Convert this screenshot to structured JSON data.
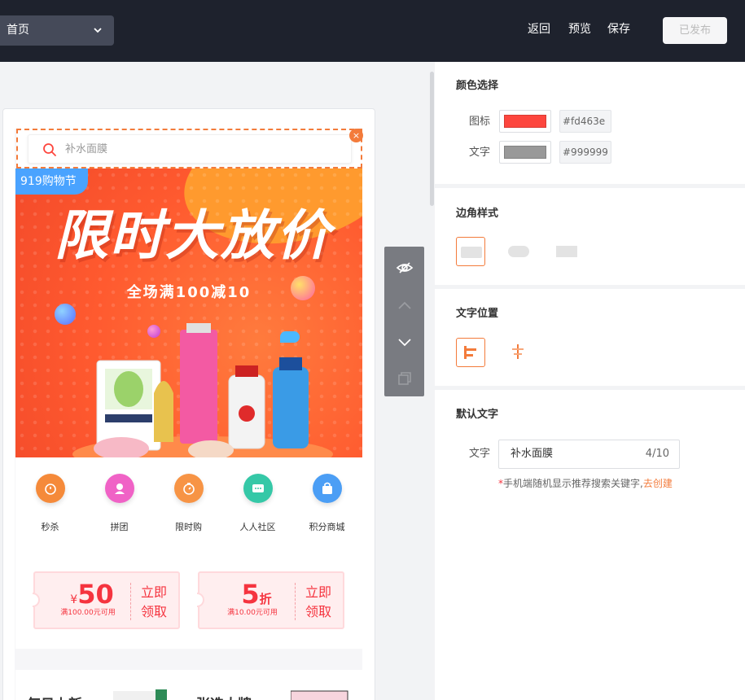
{
  "topbar": {
    "page_select": "首页",
    "back_label": "返回",
    "preview_label": "预览",
    "save_label": "保存",
    "publish_label": "已发布"
  },
  "preview": {
    "search_placeholder": "补水面膜",
    "close_symbol": "×",
    "banner": {
      "tag": "919购物节",
      "title": "限时大放价",
      "subtitle": "全场满100减10",
      "bg_color": "#ff5a2f"
    },
    "nav_items": [
      {
        "label": "秒杀",
        "color": "#f58a3a",
        "icon": "stopwatch-icon"
      },
      {
        "label": "拼团",
        "color": "#f062c6",
        "icon": "group-icon"
      },
      {
        "label": "限时购",
        "color": "#f79445",
        "icon": "timer-icon"
      },
      {
        "label": "人人社区",
        "color": "#35c8a7",
        "icon": "chat-icon"
      },
      {
        "label": "积分商城",
        "color": "#4b9ef5",
        "icon": "bag-icon"
      }
    ],
    "coupons": [
      {
        "currency": "¥",
        "amount": "50",
        "unit": "",
        "condition": "满100.00元可用",
        "cta_line1": "立即",
        "cta_line2": "领取"
      },
      {
        "currency": "",
        "amount": "5",
        "unit": "折",
        "condition": "满10.00元可用",
        "cta_line1": "立即",
        "cta_line2": "领取"
      }
    ],
    "section_titles": [
      "每日上新",
      "张选大牌"
    ]
  },
  "panel": {
    "color_section": {
      "title": "颜色选择",
      "rows": [
        {
          "label": "图标",
          "color": "#fd463e",
          "hex": "#fd463e"
        },
        {
          "label": "文字",
          "color": "#999999",
          "hex": "#999999"
        }
      ]
    },
    "corner_section": {
      "title": "边角样式"
    },
    "text_pos_section": {
      "title": "文字位置"
    },
    "default_text_section": {
      "title": "默认文字",
      "label": "文字",
      "value": "补水面膜",
      "counter": "4/10",
      "hint_star": "*",
      "hint_text": "手机端随机显示推荐搜索关键字,",
      "hint_link": "去创建"
    }
  },
  "accent_color": "#f37b3b"
}
